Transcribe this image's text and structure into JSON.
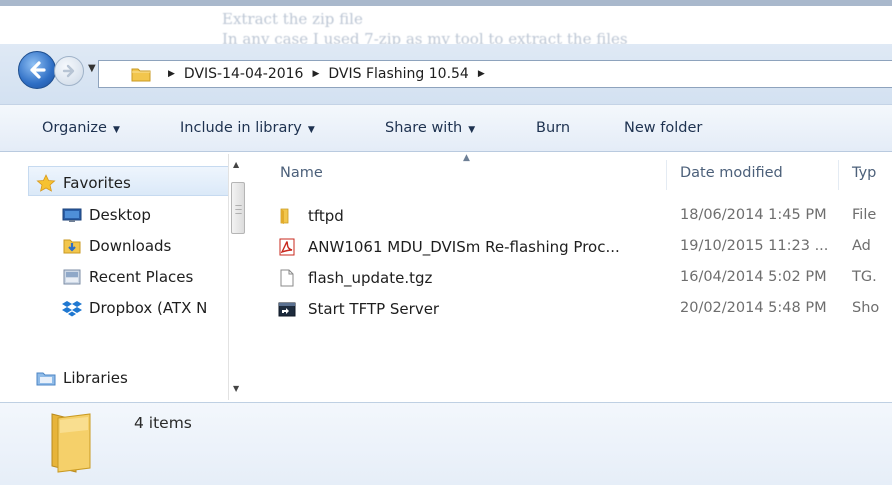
{
  "background_document": {
    "line1": "Extract the zip file",
    "line2": "In any case I used 7-zip as my tool to extract the files"
  },
  "nav": {
    "back_icon": "back-arrow-icon",
    "forward_icon": "forward-arrow-icon",
    "history_dropdown_icon": "chevron-down-icon"
  },
  "address": {
    "root_icon": "folder-icon",
    "crumbs": [
      "DVIS-14-04-2016",
      "DVIS Flashing 10.54"
    ]
  },
  "toolbar": {
    "organize": "Organize",
    "include_in_library": "Include in library",
    "share_with": "Share with",
    "burn": "Burn",
    "new_folder": "New folder"
  },
  "navpane": {
    "favorites": "Favorites",
    "desktop": "Desktop",
    "downloads": "Downloads",
    "recent_places": "Recent Places",
    "dropbox": "Dropbox (ATX N",
    "libraries": "Libraries"
  },
  "columns": {
    "name": "Name",
    "date_modified": "Date modified",
    "type": "Typ"
  },
  "files": [
    {
      "name": "tftpd",
      "date": "18/06/2014 1:45 PM",
      "type": "File",
      "icon": "folder-icon"
    },
    {
      "name": "ANW1061 MDU_DVISm Re-flashing Proc...",
      "date": "19/10/2015 11:23 ...",
      "type": "Ad",
      "icon": "pdf-icon"
    },
    {
      "name": "flash_update.tgz",
      "date": "16/04/2014 5:02 PM",
      "type": "TG.",
      "icon": "file-icon"
    },
    {
      "name": "Start TFTP Server",
      "date": "20/02/2014 5:48 PM",
      "type": "Sho",
      "icon": "shortcut-icon"
    }
  ],
  "details": {
    "item_count": "4 items"
  },
  "colors": {
    "accent_blue": "#2f6fc5",
    "folder_yellow": "#f2c64d",
    "pdf_red": "#c8281e"
  }
}
